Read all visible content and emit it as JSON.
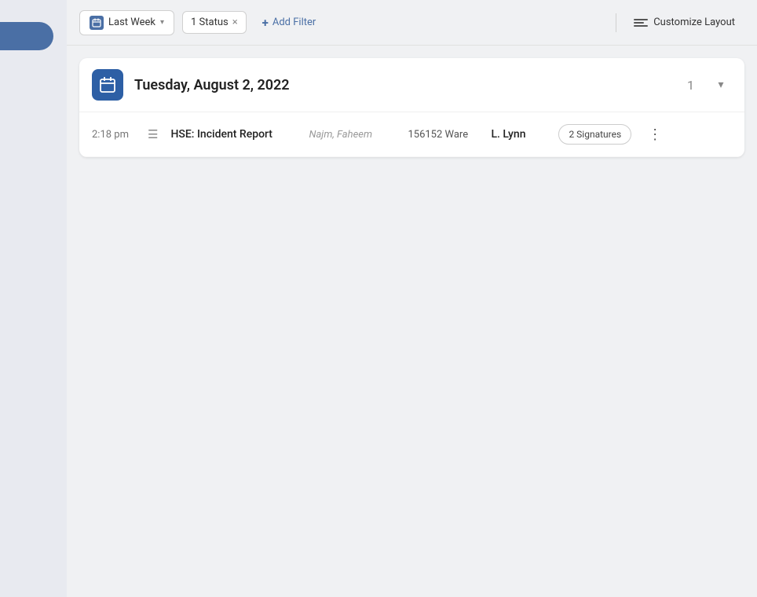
{
  "sidebar": {
    "indicator_color": "#4a6fa5"
  },
  "toolbar": {
    "date_filter_label": "Last Week",
    "status_filter_label": "1 Status",
    "add_filter_label": "Add Filter",
    "customize_layout_label": "Customize Layout",
    "plus_icon": "+",
    "chevron_icon": "▾",
    "close_icon": "×"
  },
  "date_group": {
    "date_label": "Tuesday, August 2, 2022",
    "count": "1",
    "expand_icon": "▾"
  },
  "records": [
    {
      "time": "2:18 pm",
      "type_icon": "☰",
      "name": "HSE: Incident Report",
      "author": "Najm, Faheem",
      "id": "156152 Ware",
      "assignee": "L. Lynn",
      "signatures_label": "2 Signatures",
      "more_icon": "⋮"
    }
  ]
}
